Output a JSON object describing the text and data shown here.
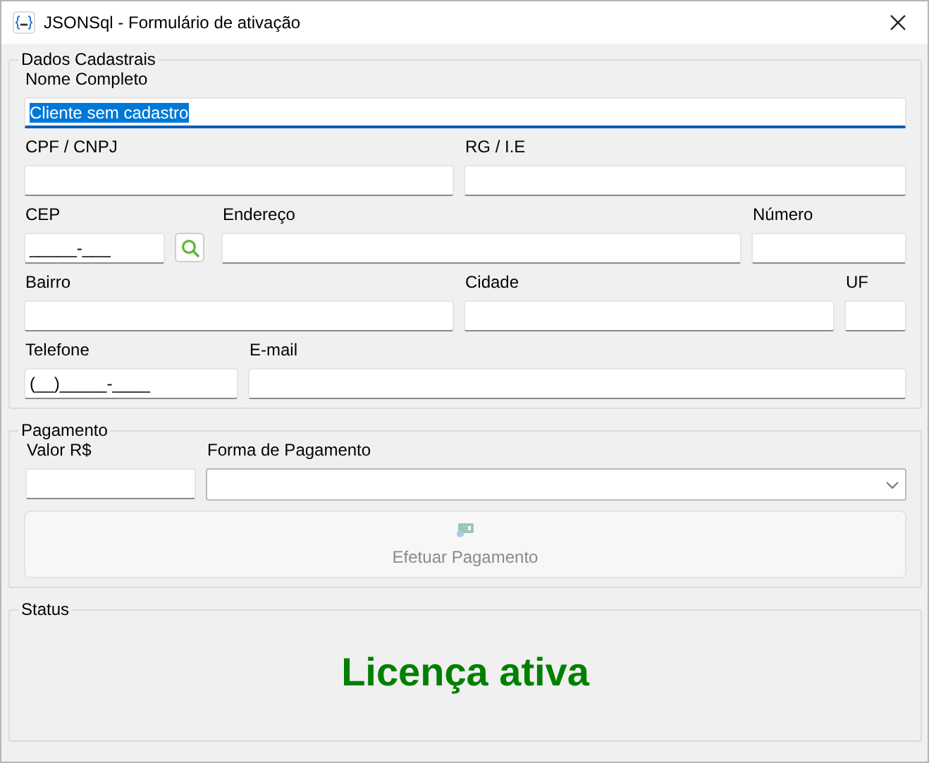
{
  "window": {
    "title": "JSONSql - Formulário de ativação"
  },
  "registration": {
    "title": "Dados Cadastrais",
    "rows": [
      [
        {
          "kind": "text",
          "label": "Nome Completo",
          "value": "Cliente sem cadastro",
          "focused": true,
          "text_selected": true
        }
      ],
      [
        {
          "kind": "text",
          "label": "CPF / CNPJ"
        },
        {
          "kind": "text",
          "label": "RG / I.E"
        }
      ],
      [
        {
          "kind": "text",
          "label": "CEP",
          "value": "_____-___"
        },
        {
          "kind": "search"
        },
        {
          "kind": "text",
          "label": "Endereço"
        },
        {
          "kind": "text",
          "label": "Número"
        }
      ],
      [
        {
          "kind": "text",
          "label": "Bairro"
        },
        {
          "kind": "text",
          "label": "Cidade"
        },
        {
          "kind": "text",
          "label": "UF"
        }
      ],
      [
        {
          "kind": "text",
          "label": "Telefone",
          "value": "(__)_____-____"
        },
        {
          "kind": "text",
          "label": "E-mail"
        }
      ]
    ]
  },
  "payment": {
    "title": "Pagamento",
    "amount_label": "Valor R$",
    "method_label": "Forma de Pagamento",
    "button": {
      "label": "Efetuar Pagamento",
      "disabled": true
    }
  },
  "status": {
    "title": "Status",
    "message": "Licença ativa"
  }
}
